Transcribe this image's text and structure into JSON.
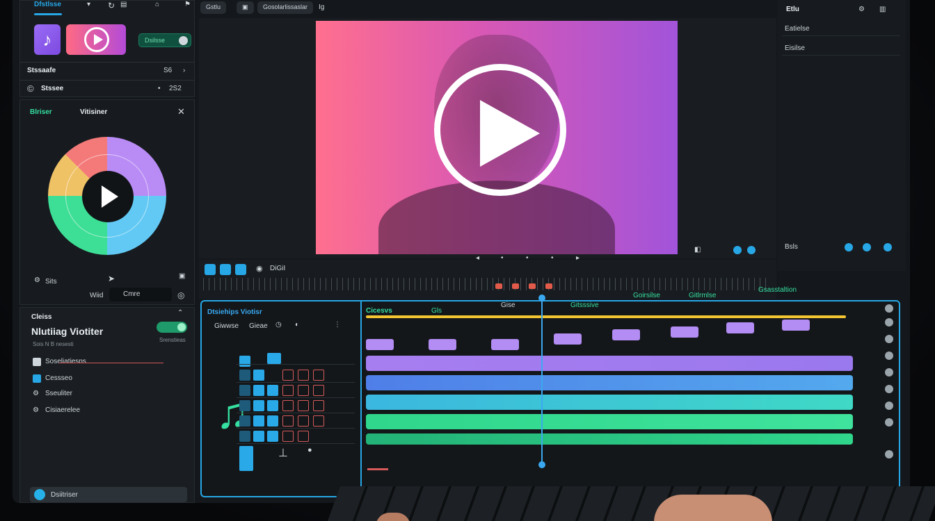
{
  "top_left": {
    "tab_label": "Dfstlsse",
    "tab_icons": [
      "c-icon",
      "grid-icon",
      "pin-icon",
      "flag-icon"
    ],
    "green_button": "Dsilsse",
    "row1_label": "Stssaafe",
    "row1_value": "S6",
    "row2_label": "Stssee",
    "row2_value": "2S2"
  },
  "visualizer": {
    "tab_active": "Blriser",
    "title": "Vitisiner",
    "footer_label": "Sits",
    "field_label": "Wiid",
    "field_value": "Cmre"
  },
  "left_bottom": {
    "header": "Cleiss",
    "title": "Nlutiiag Viotiter",
    "subtitle": "Sois N B nesesti",
    "sub_right": "Srenstieas",
    "items": [
      "Soseliatiesns",
      "Cessseo",
      "Sseuliter",
      "Cisiaerelee"
    ],
    "bottom_label": "Dsiitriser"
  },
  "toolbar": {
    "btn1": "Gstlu",
    "btn2": "Gosolarlissaslar",
    "extra": "Ig"
  },
  "transport": {
    "time": "DiGiI"
  },
  "right_panel": {
    "tab": "Etlu",
    "row1": "Eatielse",
    "row2": "Eisilse",
    "bottom": "Bsls"
  },
  "timeline": {
    "panel_title": "Dtsiehips Viotisr",
    "sub1": "Giwwse",
    "sub2": "Gieae",
    "track_labels": [
      "Cicesvs",
      "Gls",
      "Gise",
      "Gitsssive",
      "Goirsilse",
      "Gitlrmlse",
      "Gsasstaltion"
    ]
  },
  "colors": {
    "accent": "#27a7e6",
    "green": "#35e0a0",
    "purple": "#a77ef0",
    "yellow": "#f2c531",
    "preview_left": "#ff6f8e",
    "preview_right": "#a254da"
  }
}
